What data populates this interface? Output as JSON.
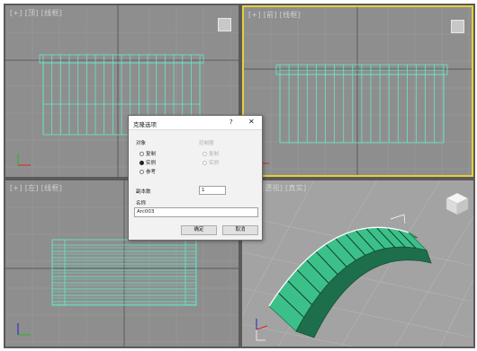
{
  "viewports": {
    "top": {
      "label": "[+] [顶] [线框]"
    },
    "front": {
      "label": "[+] [前] [线框]"
    },
    "left": {
      "label": "[+] [左] [线框]"
    },
    "persp": {
      "label": "[+] [透视] [真实]"
    }
  },
  "dialog": {
    "title": "克隆选项",
    "help": "?",
    "close": "✕",
    "object_group": "对象",
    "controller_group": "控制器",
    "object_options": [
      {
        "label": "复制",
        "selected": false
      },
      {
        "label": "实例",
        "selected": true
      },
      {
        "label": "参考",
        "selected": false
      }
    ],
    "controller_options": [
      {
        "label": "复制",
        "selected": true
      },
      {
        "label": "实例",
        "selected": false
      }
    ],
    "copies_label": "副本数",
    "copies_value": "1",
    "name_label": "名称",
    "name_value": "Arc003",
    "ok": "确定",
    "cancel": "取消"
  },
  "colors": {
    "wire": "#66e8c8",
    "active_border": "#e6cf3a",
    "viewport_bg": "#8e8e8e"
  }
}
